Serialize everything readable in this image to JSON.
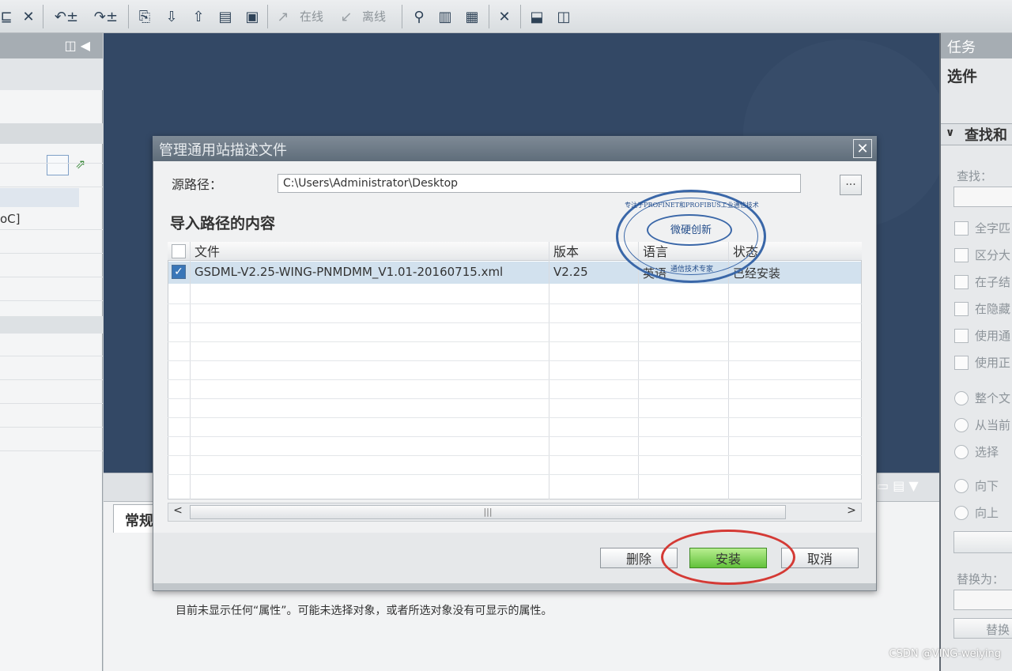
{
  "toolbar": {
    "online_label": "在线",
    "offline_label": "离线"
  },
  "inspector": {
    "tab_general": "常规",
    "message": "目前未显示任何“属性”。可能未选择对象，或者所选对象没有可显示的属性。"
  },
  "left_panel": {
    "partial_text": "oC]"
  },
  "task_panel": {
    "title": "任务",
    "options": "选件",
    "find_section": "查找和",
    "find_label": "查找：",
    "checkbox_labels": [
      "全字匹",
      "区分大",
      "在子结",
      "在隐藏",
      "使用通",
      "使用正"
    ],
    "radio_scope": [
      "整个文",
      "从当前",
      "选择"
    ],
    "radio_direction": [
      "向下",
      "向上"
    ],
    "replace_label": "替换为：",
    "replace_button": "替换"
  },
  "dialog": {
    "title": "管理通用站描述文件",
    "close": "✕",
    "source_label": "源路径：",
    "source_path": "C:\\Users\\Administrator\\Desktop",
    "browse": "...",
    "section_title": "导入路径的内容",
    "columns": {
      "file": "文件",
      "version": "版本",
      "language": "语言",
      "status": "状态"
    },
    "rows": [
      {
        "file": "GSDML-V2.25-WING-PNMDMM_V1.01-20160715.xml",
        "version": "V2.25",
        "language": "英语",
        "status": "已经安装",
        "checked": true
      }
    ],
    "buttons": {
      "delete": "删除",
      "install": "安装",
      "cancel": "取消"
    }
  },
  "stamp": {
    "center": "微硬创新",
    "top": "专注于PROFINET和PROFIBUS工业通信技术",
    "bottom": "通信技术专家",
    "color": "#3a67a8"
  },
  "watermark": "CSDN @VING-weiying",
  "colors": {
    "editor_background": "#334865",
    "install_button": "#62c13b",
    "highlight_ellipse": "#d43a35",
    "selected_row": "#d2e1ee"
  }
}
